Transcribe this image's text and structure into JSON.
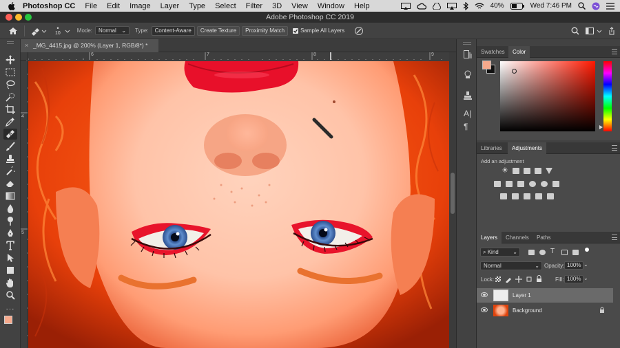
{
  "menubar": {
    "app_name": "Photoshop CC",
    "items": [
      "File",
      "Edit",
      "Image",
      "Layer",
      "Type",
      "Select",
      "Filter",
      "3D",
      "View",
      "Window",
      "Help"
    ],
    "battery": "40%",
    "clock": "Wed 7:46 PM"
  },
  "window": {
    "title": "Adobe Photoshop CC 2019"
  },
  "options": {
    "brush_size": "10",
    "mode_label": "Mode:",
    "mode_value": "Normal",
    "type_label": "Type:",
    "type_buttons": [
      "Content-Aware",
      "Create Texture",
      "Proximity Match"
    ],
    "sample_all_layers": "Sample All Layers"
  },
  "document": {
    "tab_title": "_MG_4415.jpg @ 200% (Layer 1, RGB/8*) *",
    "ruler_h": [
      "6",
      "7",
      "8",
      "9"
    ],
    "ruler_v": [
      "4",
      "5"
    ]
  },
  "panels": {
    "color_tabs": [
      "Swatches",
      "Color"
    ],
    "adjust_tabs": [
      "Libraries",
      "Adjustments"
    ],
    "add_adjustment": "Add an adjustment",
    "layers_tabs": [
      "Layers",
      "Channels",
      "Paths"
    ],
    "kind_filter": "Kind",
    "blend_mode": "Normal",
    "opacity_label": "Opacity:",
    "opacity_value": "100%",
    "lock_label": "Lock:",
    "fill_label": "Fill:",
    "fill_value": "100%",
    "layers": [
      {
        "name": "Layer 1"
      },
      {
        "name": "Background"
      }
    ]
  },
  "colors": {
    "foreground": "#f6a98c",
    "background": "#111111",
    "accent": "#2d8cf0"
  }
}
